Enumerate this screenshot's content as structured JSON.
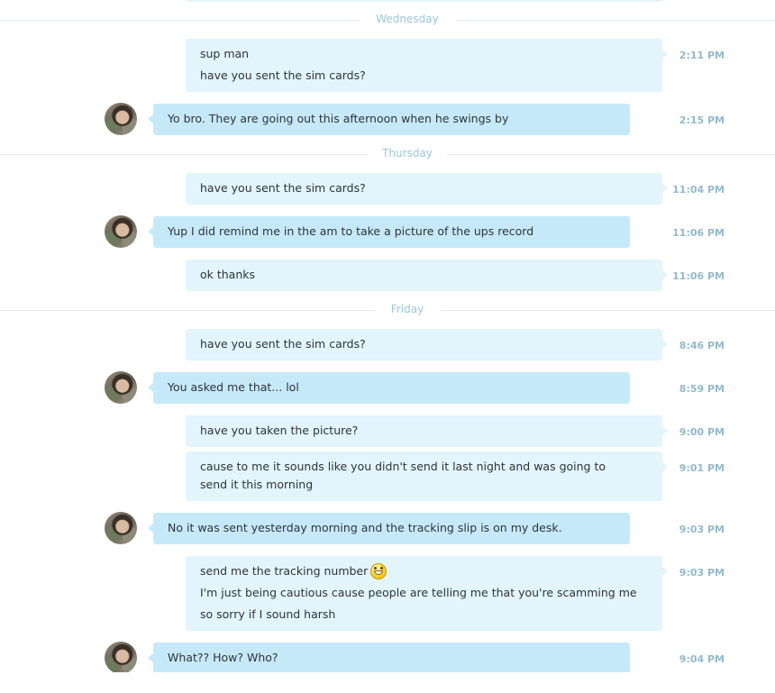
{
  "days": [
    "Wednesday",
    "Thursday",
    "Friday"
  ],
  "messages": [
    {
      "lines": [
        "sup man",
        "have you sent the sim cards?"
      ],
      "time": "2:11 PM"
    },
    {
      "lines": [
        "Yo bro. They are going out this afternoon when he swings by"
      ],
      "time": "2:15 PM"
    },
    {
      "lines": [
        "have you sent the sim cards?"
      ],
      "time": "11:04 PM"
    },
    {
      "lines": [
        "Yup I did remind me in the am to take a picture of the ups record"
      ],
      "time": "11:06 PM"
    },
    {
      "lines": [
        "ok thanks"
      ],
      "time": "11:06 PM"
    },
    {
      "lines": [
        "have you sent the sim cards?"
      ],
      "time": "8:46 PM"
    },
    {
      "lines": [
        "You asked me that... lol"
      ],
      "time": "8:59 PM"
    },
    {
      "lines": [
        "have you taken the picture?"
      ],
      "time": "9:00 PM"
    },
    {
      "lines": [
        "cause to me it sounds like you didn't send it last night and was going to send it this morning"
      ],
      "time": "9:01 PM"
    },
    {
      "lines": [
        "No it was sent yesterday morning and the tracking slip is on my desk."
      ],
      "time": "9:03 PM"
    },
    {
      "lines": [
        "send me the tracking number",
        "I'm just being cautious cause people are telling me that you're scamming me",
        "so sorry if I sound harsh"
      ],
      "time": "9:03 PM",
      "emoji": "grin-emoji-icon"
    },
    {
      "lines": [
        "What?? How? Who?"
      ],
      "time": "9:04 PM"
    }
  ]
}
